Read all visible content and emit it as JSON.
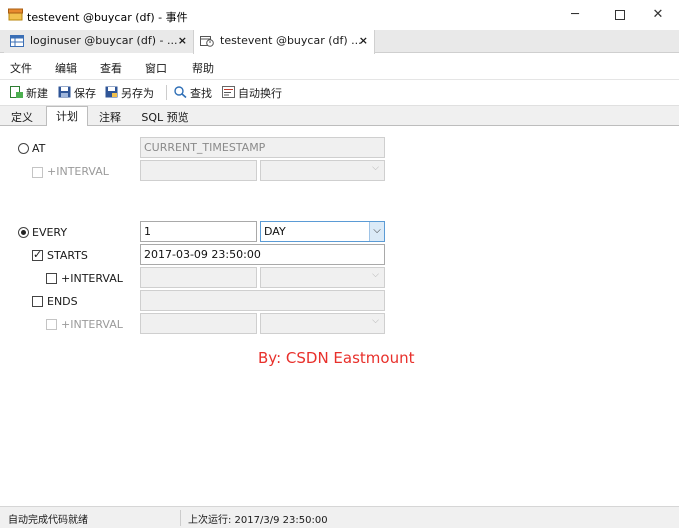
{
  "window": {
    "title": "testevent @buycar (df) - 事件",
    "icon": "event-database-icon",
    "controls": {
      "minimize": "─",
      "close": "✕"
    }
  },
  "doc_tabs": [
    {
      "label": "loginuser @buycar (df) - ...",
      "icon": "table-icon",
      "close": "×",
      "active": false
    },
    {
      "label": "testevent @buycar (df) ...",
      "icon": "event-icon",
      "close": "×",
      "active": true
    }
  ],
  "menu": [
    "文件",
    "编辑",
    "查看",
    "窗口",
    "帮助"
  ],
  "toolbar": {
    "new_label": "新建",
    "save_label": "保存",
    "save_as_label": "另存为",
    "find_label": "查找",
    "wrap_label": "自动换行"
  },
  "sub_tabs": [
    {
      "label": "定义",
      "active": false
    },
    {
      "label": "计划",
      "active": true
    },
    {
      "label": "注释",
      "active": false
    },
    {
      "label": "SQL 预览",
      "active": false
    }
  ],
  "schedule": {
    "at": {
      "label": "AT",
      "selected": false,
      "value": "CURRENT_TIMESTAMP"
    },
    "at_interval": {
      "label": "+INTERVAL",
      "checked": false,
      "value": "",
      "unit": ""
    },
    "every": {
      "label": "EVERY",
      "selected": true,
      "value": "1",
      "unit": "DAY"
    },
    "starts": {
      "label": "STARTS",
      "checked": true,
      "value": "2017-03-09 23:50:00"
    },
    "starts_interval": {
      "label": "+INTERVAL",
      "checked": false,
      "value": "",
      "unit": ""
    },
    "ends": {
      "label": "ENDS",
      "checked": false,
      "value": ""
    },
    "ends_interval": {
      "label": "+INTERVAL",
      "checked": false,
      "value": "",
      "unit": ""
    }
  },
  "watermark": "By:  CSDN Eastmount",
  "status": {
    "left": "自动完成代码就绪",
    "last_run": "上次运行: 2017/3/9 23:50:00"
  },
  "colors": {
    "watermark": "#e8302b",
    "focus_border": "#5b9bd5"
  }
}
